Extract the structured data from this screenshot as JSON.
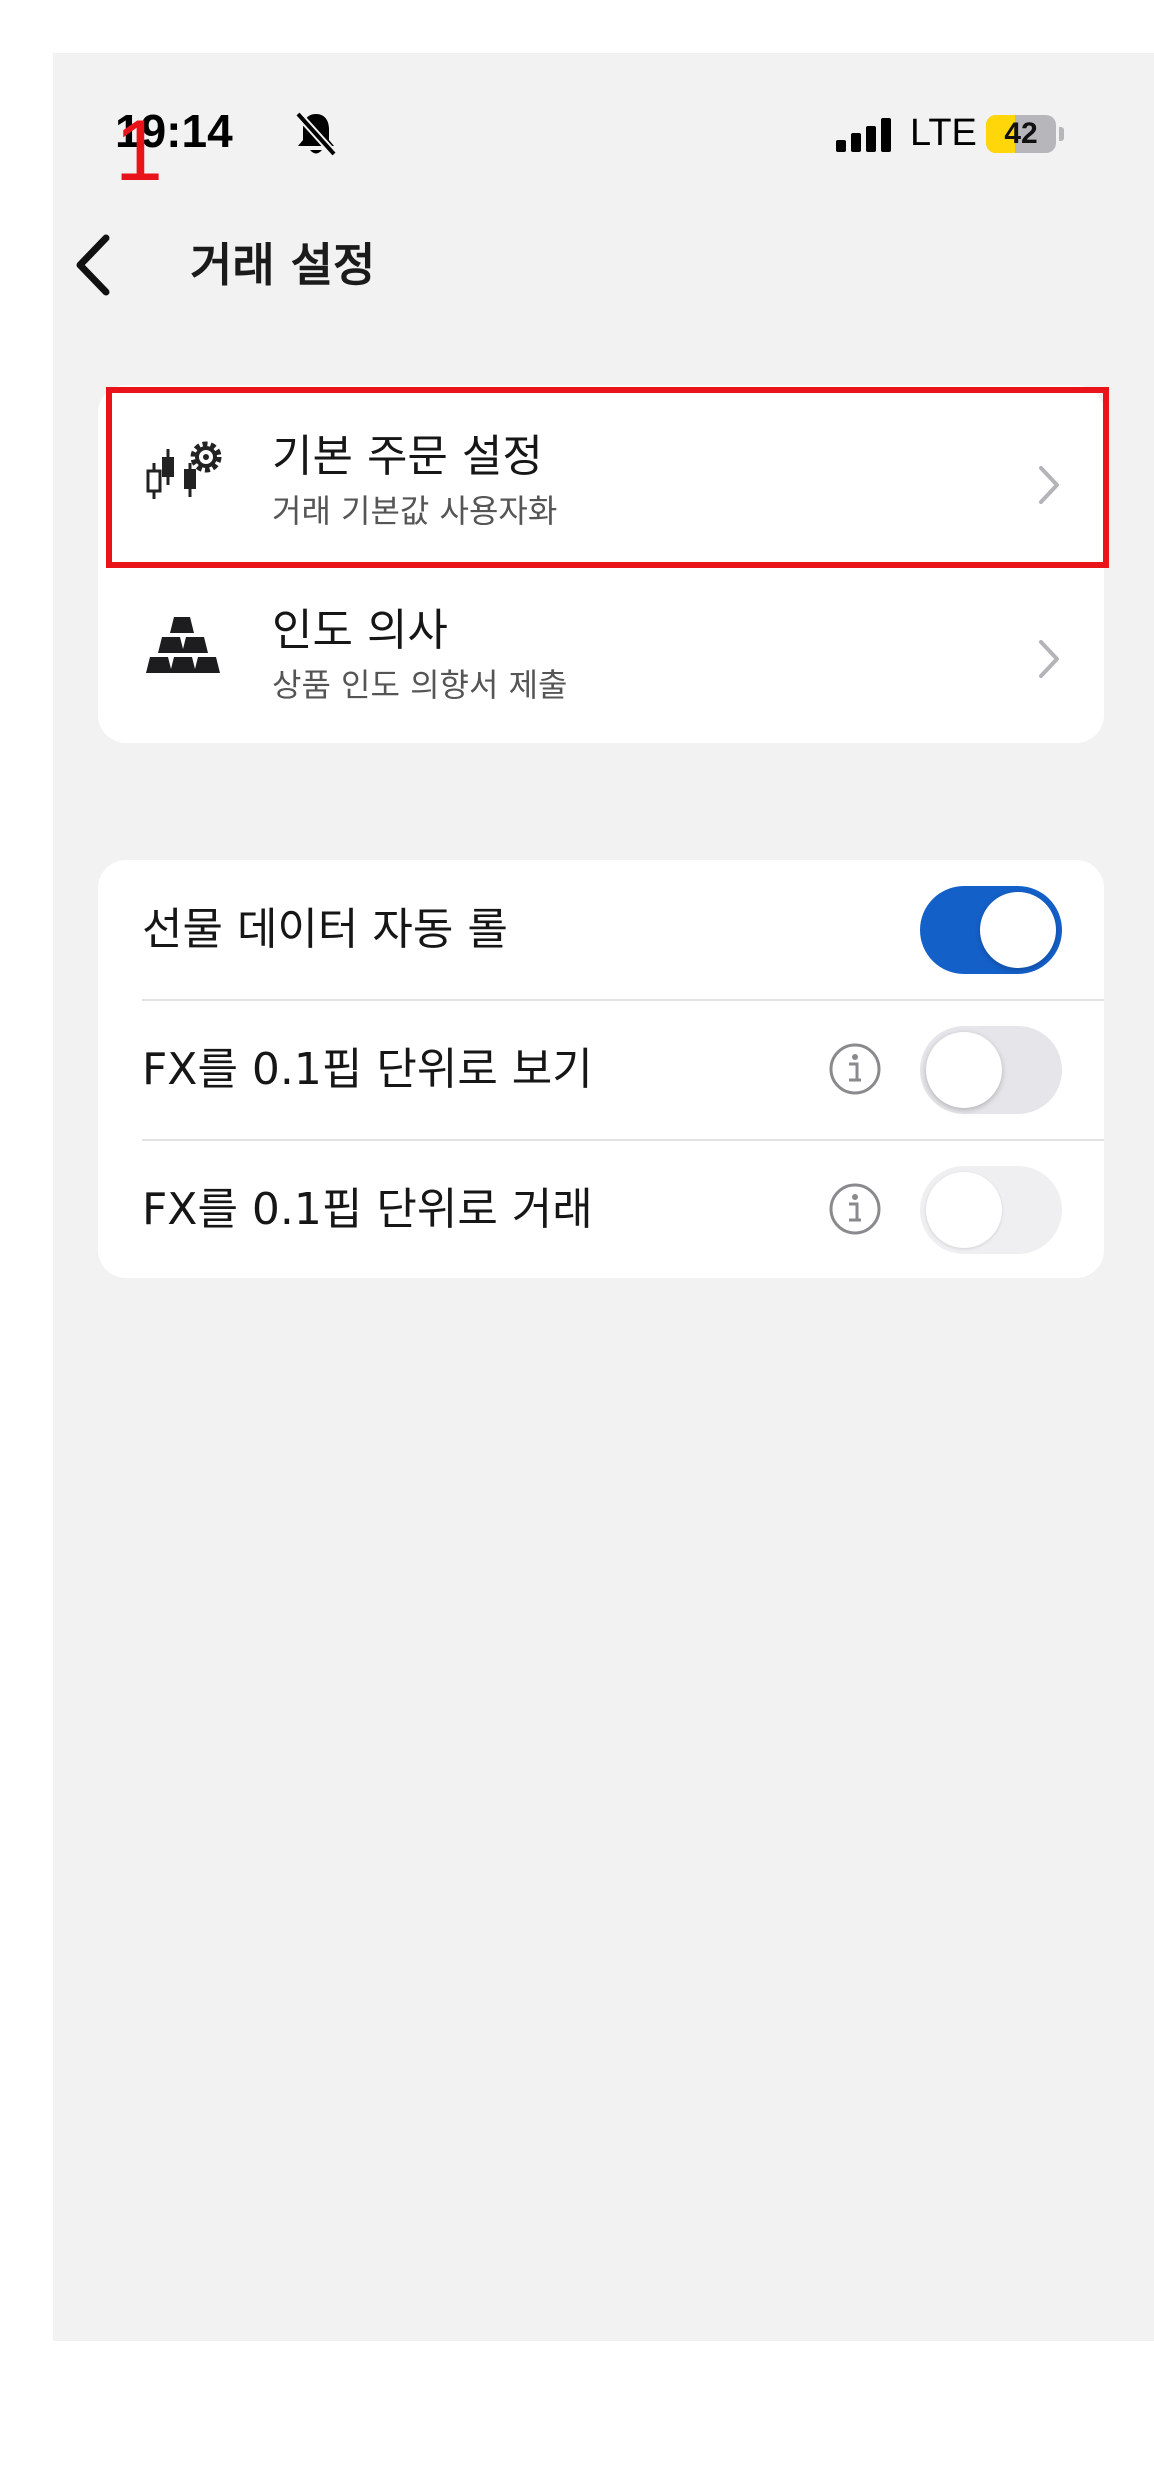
{
  "annotation": {
    "label": "1"
  },
  "status_bar": {
    "time": "19:14",
    "network": "LTE",
    "battery_level": "42",
    "battery_percent": 42,
    "silent_mode": true
  },
  "nav": {
    "title": "거래 설정"
  },
  "menu": {
    "items": [
      {
        "title": "기본 주문 설정",
        "subtitle": "거래 기본값 사용자화",
        "icon": "candlestick-gear-icon"
      },
      {
        "title": "인도 의사",
        "subtitle": "상품 인도 의향서 제출",
        "icon": "gold-bars-icon"
      }
    ]
  },
  "toggles": {
    "items": [
      {
        "label": "선물 데이터 자동 롤",
        "on": true,
        "info": false
      },
      {
        "label": "FX를 0.1핍 단위로 보기",
        "on": false,
        "info": true
      },
      {
        "label": "FX를 0.1핍 단위로 거래",
        "on": false,
        "info": true,
        "disabled": true
      }
    ]
  },
  "colors": {
    "accent": "#1460c9",
    "highlight": "#e8141a",
    "background": "#f2f2f3",
    "battery": "#ffd60a"
  }
}
